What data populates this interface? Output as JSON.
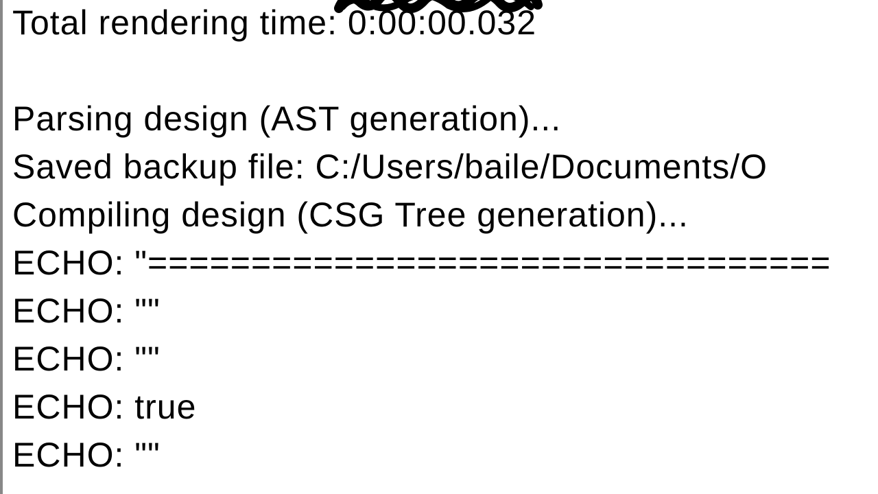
{
  "console": {
    "lines": [
      "Total rendering time: 0:00:00.032",
      "",
      "Parsing design (AST generation)...",
      "Saved backup file: C:/Users/baile/Documents/O",
      "Compiling design (CSG Tree generation)...",
      "ECHO: \"=================================",
      "ECHO: \"\"",
      "ECHO: \"\"",
      "ECHO: true",
      "ECHO: \"\""
    ]
  }
}
